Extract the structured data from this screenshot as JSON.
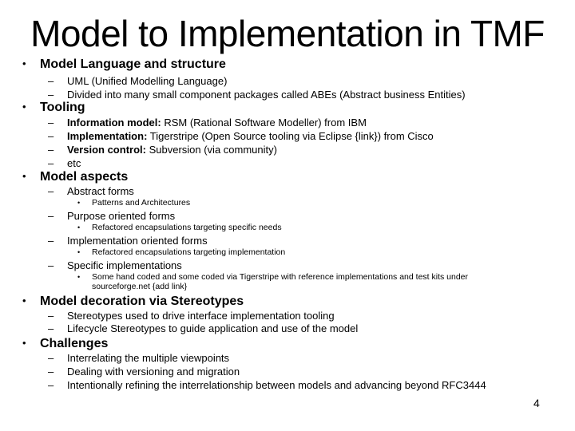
{
  "slide": {
    "title": "Model to Implementation in TMF",
    "page_number": "4",
    "markers": {
      "level1": "•",
      "level2": "–",
      "level3": "•"
    },
    "sections": [
      {
        "heading": "Model Language and structure",
        "items": [
          {
            "text": "UML (Unified Modelling Language)"
          },
          {
            "text": "Divided into many small component packages called ABEs (Abstract business Entities)"
          }
        ]
      },
      {
        "heading": "Tooling",
        "items": [
          {
            "label": "Information model:",
            "text": " RSM (Rational Software Modeller) from IBM"
          },
          {
            "label": "Implementation:",
            "text": " Tigerstripe (Open Source tooling via Eclipse {link}) from Cisco"
          },
          {
            "label": "Version control:",
            "text": " Subversion (via community)"
          },
          {
            "text": "etc"
          }
        ]
      },
      {
        "heading": "Model aspects",
        "items": [
          {
            "text": "Abstract forms",
            "sub": [
              "Patterns and Architectures"
            ]
          },
          {
            "text": "Purpose oriented forms",
            "sub": [
              "Refactored encapsulations targeting specific needs"
            ]
          },
          {
            "text": "Implementation oriented forms",
            "sub": [
              "Refactored encapsulations targeting implementation"
            ]
          },
          {
            "text": "Specific implementations",
            "sub": [
              "Some hand coded and some coded via Tigerstripe with reference implementations and test kits under",
              "sourceforge.net {add link}"
            ]
          }
        ]
      },
      {
        "heading": "Model decoration via Stereotypes",
        "items": [
          {
            "text": "Stereotypes used to drive interface implementation tooling"
          },
          {
            "text": "Lifecycle Stereotypes to guide application and use of the model"
          }
        ]
      },
      {
        "heading": "Challenges",
        "items": [
          {
            "text": "Interrelating the multiple viewpoints"
          },
          {
            "text": "Dealing with versioning and migration"
          },
          {
            "text": "Intentionally refining the interrelationship between models and advancing beyond RFC3444"
          }
        ]
      }
    ]
  }
}
